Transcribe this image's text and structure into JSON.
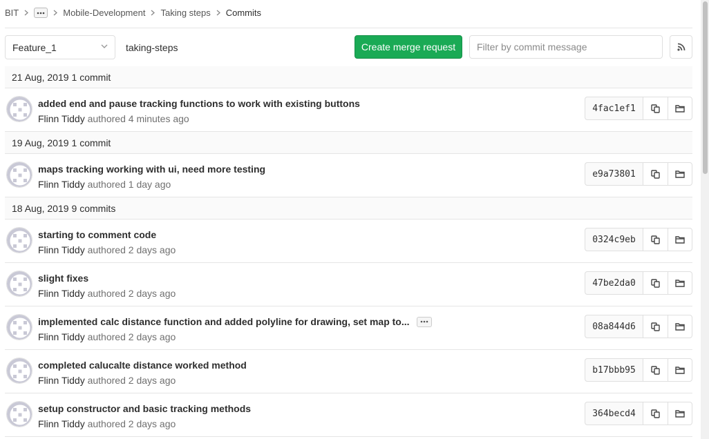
{
  "breadcrumb": {
    "items": [
      "BIT",
      "Mobile-Development",
      "Taking steps"
    ],
    "current": "Commits"
  },
  "controls": {
    "branch": "Feature_1",
    "path": "taking-steps",
    "merge_request_label": "Create merge request",
    "filter_placeholder": "Filter by commit message"
  },
  "colors": {
    "accent_green": "#1aaa55"
  },
  "groups": [
    {
      "date": "21 Aug, 2019",
      "count": "1 commit",
      "commits": [
        {
          "title": "added end and pause tracking functions to work with existing buttons",
          "author": "Flinn Tiddy",
          "authored": "authored",
          "time": "4 minutes ago",
          "sha": "4fac1ef1"
        }
      ]
    },
    {
      "date": "19 Aug, 2019",
      "count": "1 commit",
      "commits": [
        {
          "title": "maps tracking working with ui, need more testing",
          "author": "Flinn Tiddy",
          "authored": "authored",
          "time": "1 day ago",
          "sha": "e9a73801"
        }
      ]
    },
    {
      "date": "18 Aug, 2019",
      "count": "9 commits",
      "commits": [
        {
          "title": "starting to comment code",
          "author": "Flinn Tiddy",
          "authored": "authored",
          "time": "2 days ago",
          "sha": "0324c9eb"
        },
        {
          "title": "slight fixes",
          "author": "Flinn Tiddy",
          "authored": "authored",
          "time": "2 days ago",
          "sha": "47be2da0"
        },
        {
          "title": "implemented calc distance function and added polyline for drawing, set map to...",
          "author": "Flinn Tiddy",
          "authored": "authored",
          "time": "2 days ago",
          "sha": "08a844d6",
          "expandable": true
        },
        {
          "title": "completed calucalte distance worked method",
          "author": "Flinn Tiddy",
          "authored": "authored",
          "time": "2 days ago",
          "sha": "b17bbb95"
        },
        {
          "title": "setup constructor and basic tracking methods",
          "author": "Flinn Tiddy",
          "authored": "authored",
          "time": "2 days ago",
          "sha": "364becd4"
        }
      ]
    }
  ]
}
